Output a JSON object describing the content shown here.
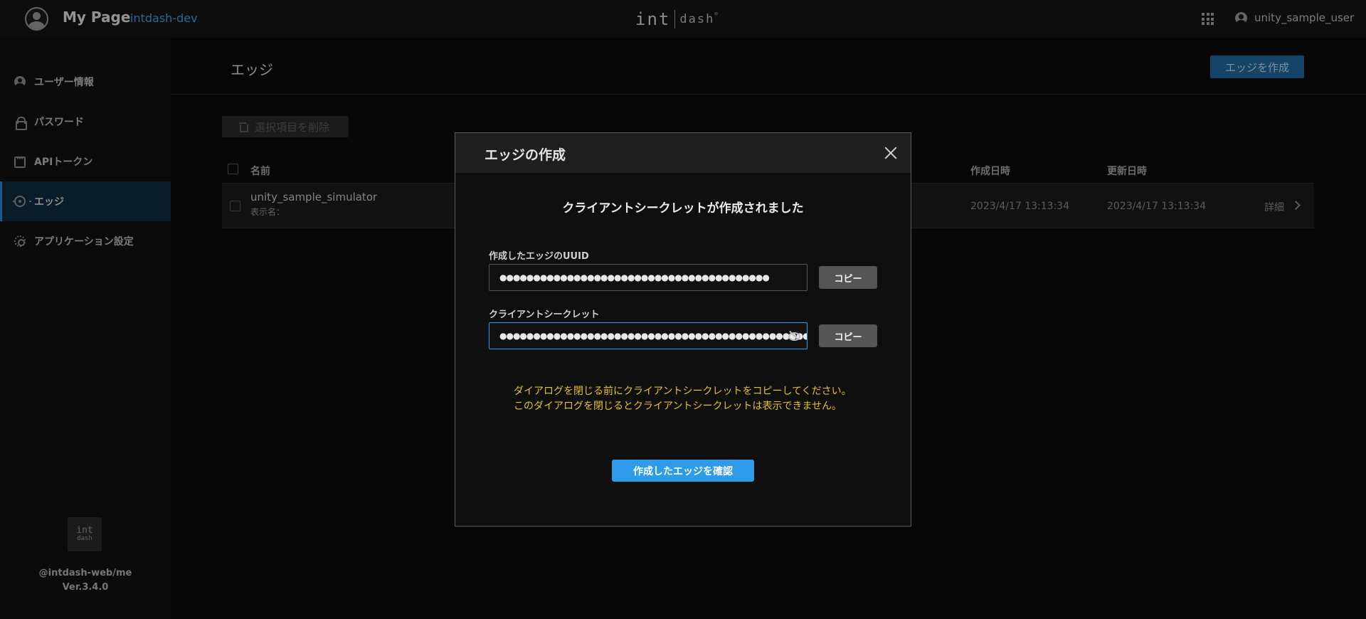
{
  "topbar": {
    "title": "My Page",
    "env": "intdash-dev",
    "brand": {
      "left": "int",
      "right": "dash",
      "mark": "®"
    },
    "user": "unity_sample_user"
  },
  "sidebar": {
    "items": [
      {
        "label": "ユーザー情報",
        "icon": "user-icon"
      },
      {
        "label": "パスワード",
        "icon": "lock-icon"
      },
      {
        "label": "APIトークン",
        "icon": "token-icon"
      },
      {
        "label": "エッジ",
        "icon": "edge-icon",
        "active": true
      },
      {
        "label": "アプリケーション設定",
        "icon": "gear-icon"
      }
    ],
    "logo": {
      "line1": "int",
      "line2": "dash"
    },
    "package": "@intdash-web/me",
    "version": "Ver.3.4.0"
  },
  "page": {
    "title": "エッジ",
    "create_button": "エッジを作成",
    "delete_button": "選択項目を削除"
  },
  "table": {
    "headers": {
      "name": "名前",
      "created": "作成日時",
      "updated": "更新日時"
    },
    "rows": [
      {
        "name": "unity_sample_simulator",
        "display_name_label": "表示名：",
        "created": "2023/4/17 13:13:34",
        "updated": "2023/4/17 13:13:34",
        "detail": "詳細"
      }
    ]
  },
  "dialog": {
    "title": "エッジの作成",
    "heading": "クライアントシークレットが作成されました",
    "uuid_label": "作成したエッジのUUID",
    "uuid_value": "●●●●●●●●●●●●●●●●●●●●●●●●●●●●●●●●●●●●●●●●",
    "secret_label": "クライアントシークレット",
    "secret_value": "●●●●●●●●●●●●●●●●●●●●●●●●●●●●●●●●●●●●●●●●●●●●●●●●●●●●●●●●●●",
    "copy_label": "コピー",
    "warning_line1": "ダイアログを閉じる前にクライアントシークレットをコピーしてください。",
    "warning_line2": "このダイアログを閉じるとクライアントシークレットは表示できません。",
    "confirm_button": "作成したエッジを確認"
  },
  "colors": {
    "accent": "#2d9be8",
    "warning": "#e3c12e",
    "env": "#3fa3e8"
  }
}
